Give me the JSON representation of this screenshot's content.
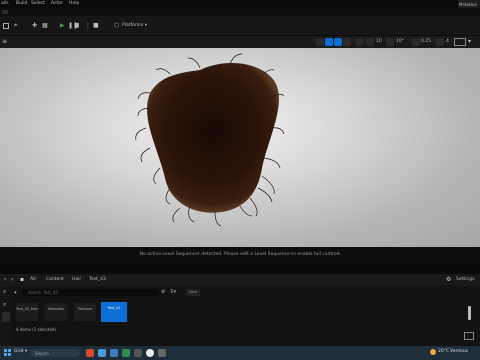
{
  "menu": {
    "items": [
      "ails",
      "Build",
      "Select",
      "Actor",
      "Help"
    ],
    "project": "MetaHun"
  },
  "toolbar": {
    "platforms_label": "Platforms"
  },
  "viewport_toolbar": {
    "fov": "0.25",
    "speed": "4",
    "grid": "10",
    "angle": "10°"
  },
  "viewport": {
    "sequencer_message": "No active Level Sequencer detected. Please edit a Level Sequence to enable full controls"
  },
  "content_browser": {
    "breadcrumb": [
      "All",
      "Content",
      "Hair",
      "Test_43"
    ],
    "settings_label": "Settings",
    "search_placeholder": "Search Test_43",
    "save_label": "Save",
    "assets": [
      {
        "label": "Test_43_Hair"
      },
      {
        "label": "Materials"
      },
      {
        "label": "Textures"
      },
      {
        "label": "Test_43"
      }
    ],
    "status": "4 items (1 selected)"
  },
  "taskbar": {
    "search_placeholder": "Search",
    "weather": "20°C",
    "weather_desc": "Ventous"
  },
  "colors": {
    "accent": "#0b6fd6",
    "play_green": "#3ea13e"
  }
}
